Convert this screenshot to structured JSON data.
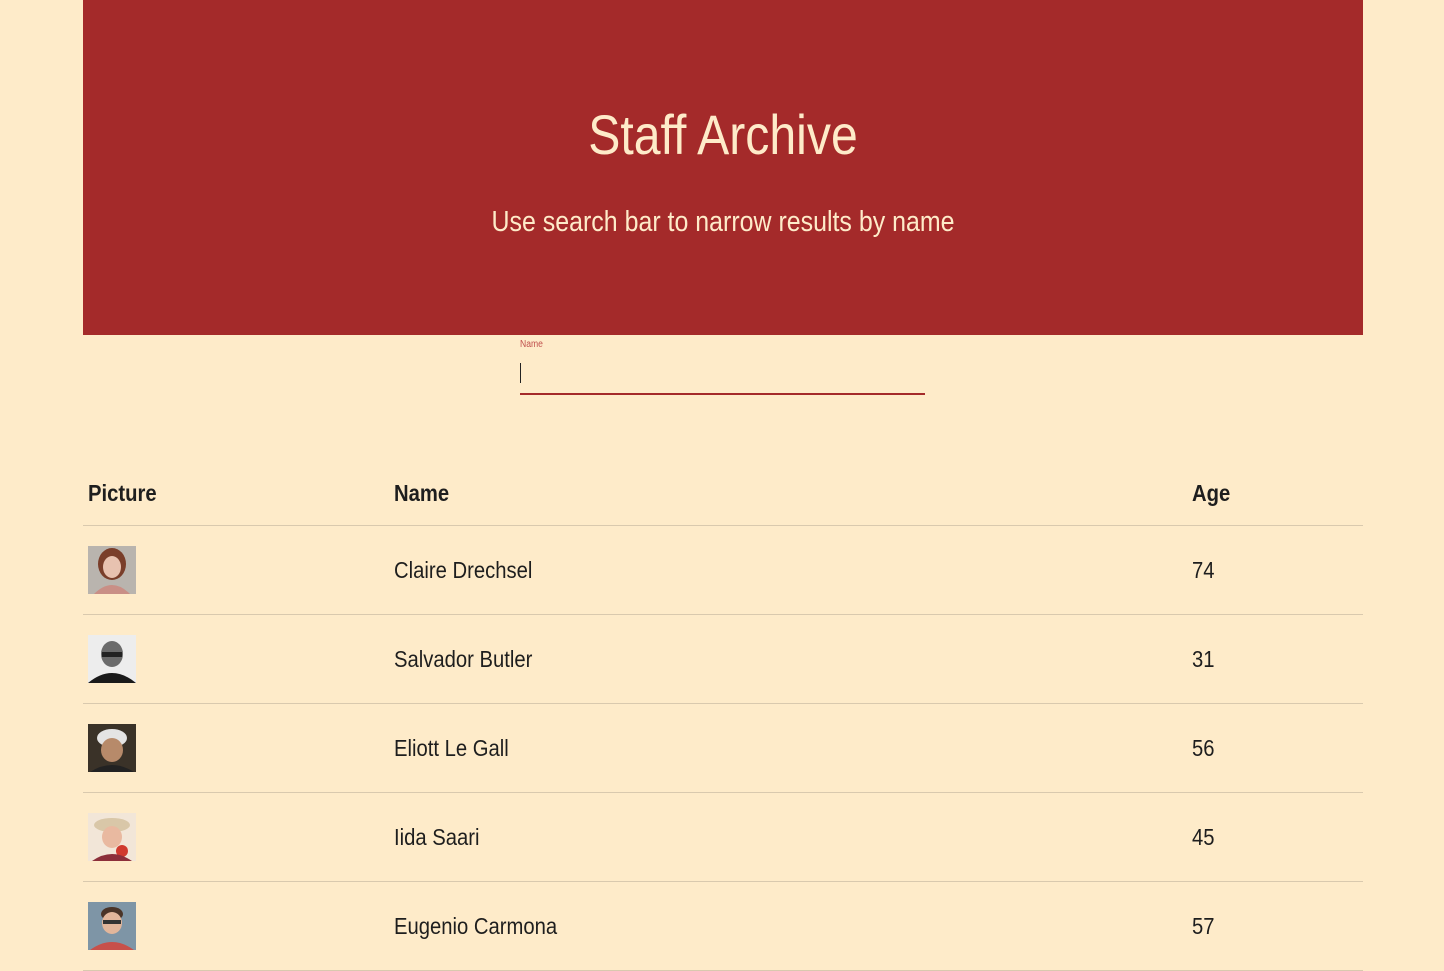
{
  "header": {
    "title": "Staff Archive",
    "subtitle": "Use search bar to narrow results by name"
  },
  "search": {
    "label": "Name",
    "value": ""
  },
  "table": {
    "columns": [
      "Picture",
      "Name",
      "Age"
    ],
    "rows": [
      {
        "name": "Claire Drechsel",
        "age": "74",
        "avatar": "female-portrait-photo"
      },
      {
        "name": "Salvador Butler",
        "age": "31",
        "avatar": "male-portrait-photo-bw"
      },
      {
        "name": "Eliott Le Gall",
        "age": "56",
        "avatar": "male-portrait-photo-cap"
      },
      {
        "name": "Iida Saari",
        "age": "45",
        "avatar": "female-portrait-photo"
      },
      {
        "name": "Eugenio Carmona",
        "age": "57",
        "avatar": "male-portrait-photo-glasses"
      }
    ]
  },
  "colors": {
    "background": "#FEEBC9",
    "accent": "#A42A2A",
    "hero_text": "#FEEBC9",
    "label": "#C0504D"
  }
}
